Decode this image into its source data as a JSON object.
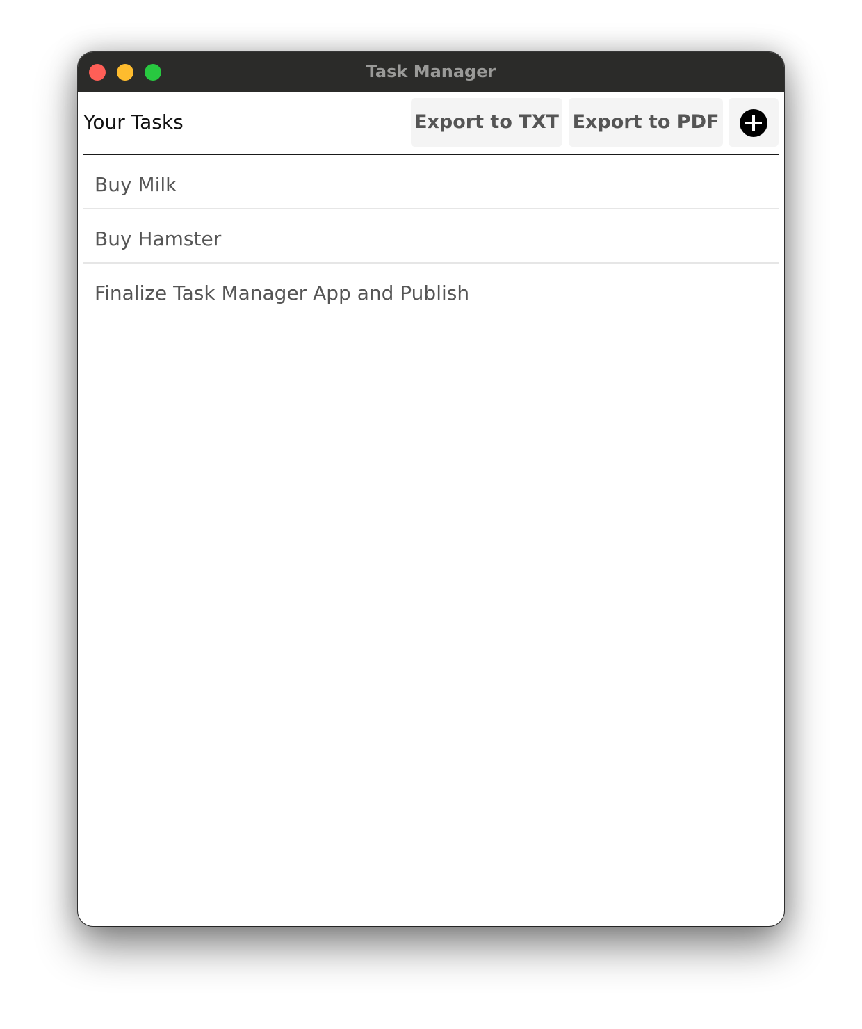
{
  "window": {
    "title": "Task Manager"
  },
  "header": {
    "title": "Your Tasks",
    "export_txt_label": "Export to TXT",
    "export_pdf_label": "Export to PDF",
    "add_icon": "plus-circle-icon"
  },
  "tasks": [
    {
      "label": "Buy Milk"
    },
    {
      "label": "Buy Hamster"
    },
    {
      "label": "Finalize Task Manager App and Publish"
    }
  ],
  "colors": {
    "titlebar": "#2b2b29",
    "close": "#ff5f57",
    "minimize": "#febc2e",
    "maximize": "#28c840",
    "button_bg": "#f4f4f4"
  }
}
